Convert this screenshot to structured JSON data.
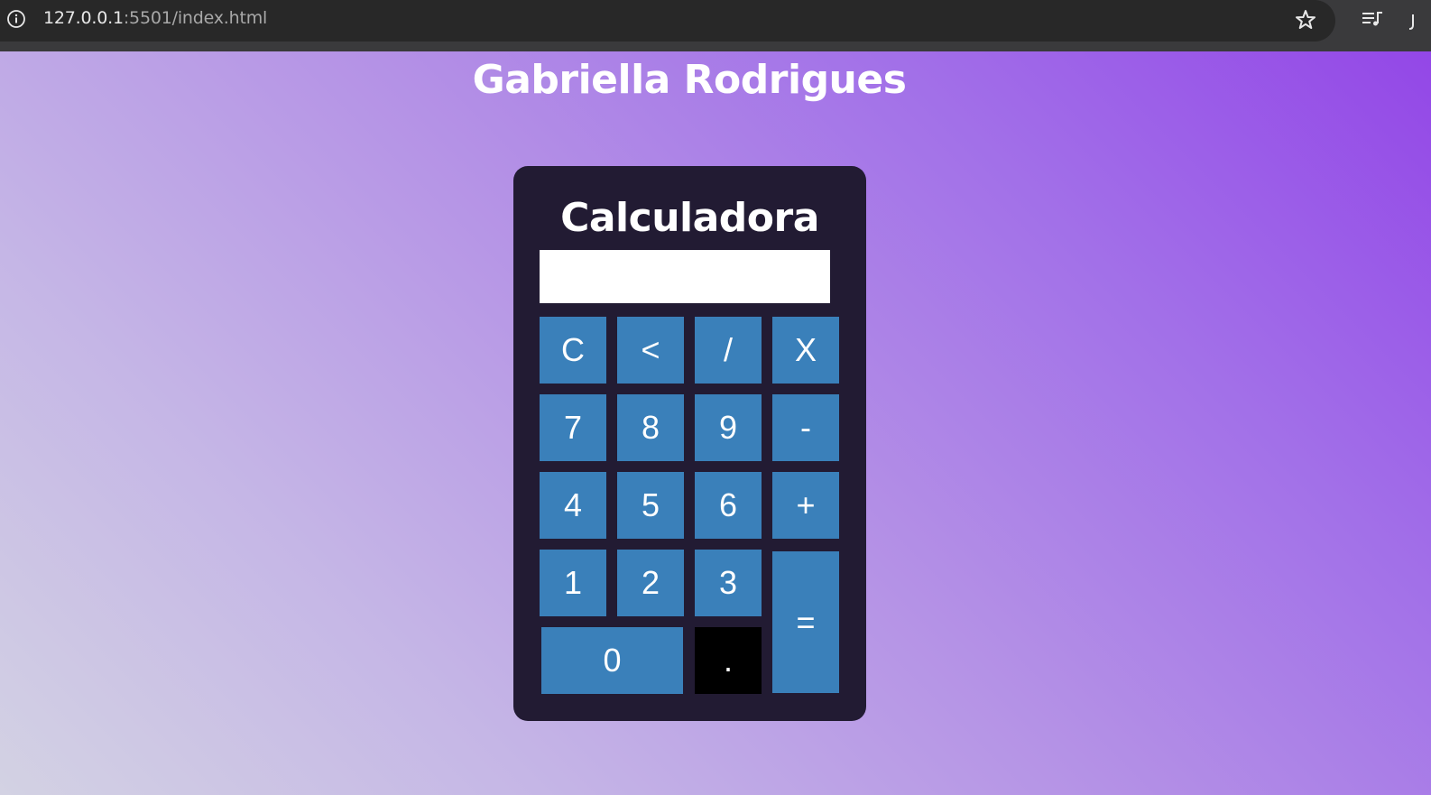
{
  "browser": {
    "url_host": "127.0.0.1",
    "url_path": ":5501/index.html",
    "icons": [
      "info-icon",
      "star-icon",
      "reading-list-icon"
    ]
  },
  "page": {
    "heading": "Gabriella Rodrigues"
  },
  "calculator": {
    "title": "Calculadora",
    "display_value": "",
    "keys": {
      "clear": "C",
      "backspace": "<",
      "divide": "/",
      "multiply": "X",
      "seven": "7",
      "eight": "8",
      "nine": "9",
      "minus": "-",
      "four": "4",
      "five": "5",
      "six": "6",
      "plus": "+",
      "one": "1",
      "two": "2",
      "three": "3",
      "equals": "=",
      "zero": "0",
      "dot": "."
    }
  },
  "colors": {
    "key_background": "#3a80ba",
    "dot_key_background": "#000000",
    "calculator_background": "#221b33",
    "gradient_start": "#d3d2e3",
    "gradient_end": "#9347e7"
  }
}
